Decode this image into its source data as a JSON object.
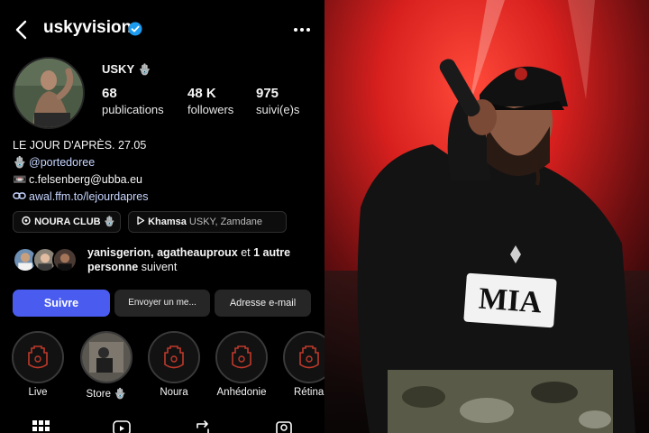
{
  "header": {
    "username": "uskyvision",
    "back_icon": "chevron-left-icon",
    "verified_icon": "verified-badge-icon",
    "more_icon": "more-horizontal-icon"
  },
  "profile": {
    "display_name": "USKY",
    "name_emoji": "🪬",
    "stats": [
      {
        "value": "68",
        "label": "publications"
      },
      {
        "value": "48 K",
        "label": "followers"
      },
      {
        "value": "975",
        "label": "suivi(e)s"
      }
    ]
  },
  "bio": {
    "line1": "LE JOUR D'APRÈS. 27.05",
    "mention_icon": "🪬",
    "mention": "@portedoree",
    "email_icon": "📼",
    "email": "c.felsenberg@ubba.eu",
    "link": "awal.ffm.to/lejourdapres"
  },
  "chips": {
    "club_label": "NOURA CLUB",
    "club_emoji": "🪬",
    "music_title": "Khamsa",
    "music_artists": "USKY, Zamdane"
  },
  "mutual": {
    "names": "yanisgerion, agatheauproux",
    "connector": "et",
    "others": "1 autre personne",
    "suffix": "suivent"
  },
  "actions": {
    "follow": "Suivre",
    "message": "Envoyer un me...",
    "email": "Adresse e-mail"
  },
  "highlights": [
    {
      "label": "Live"
    },
    {
      "label": "Store 🪬"
    },
    {
      "label": "Noura"
    },
    {
      "label": "Anhédonie"
    },
    {
      "label": "Rétina"
    }
  ],
  "photo": {
    "shirt_text": "MIA"
  },
  "colors": {
    "accent_blue": "#4a5cf0",
    "link_blue": "#c7d6ff",
    "stage_red": "#d8201e"
  }
}
